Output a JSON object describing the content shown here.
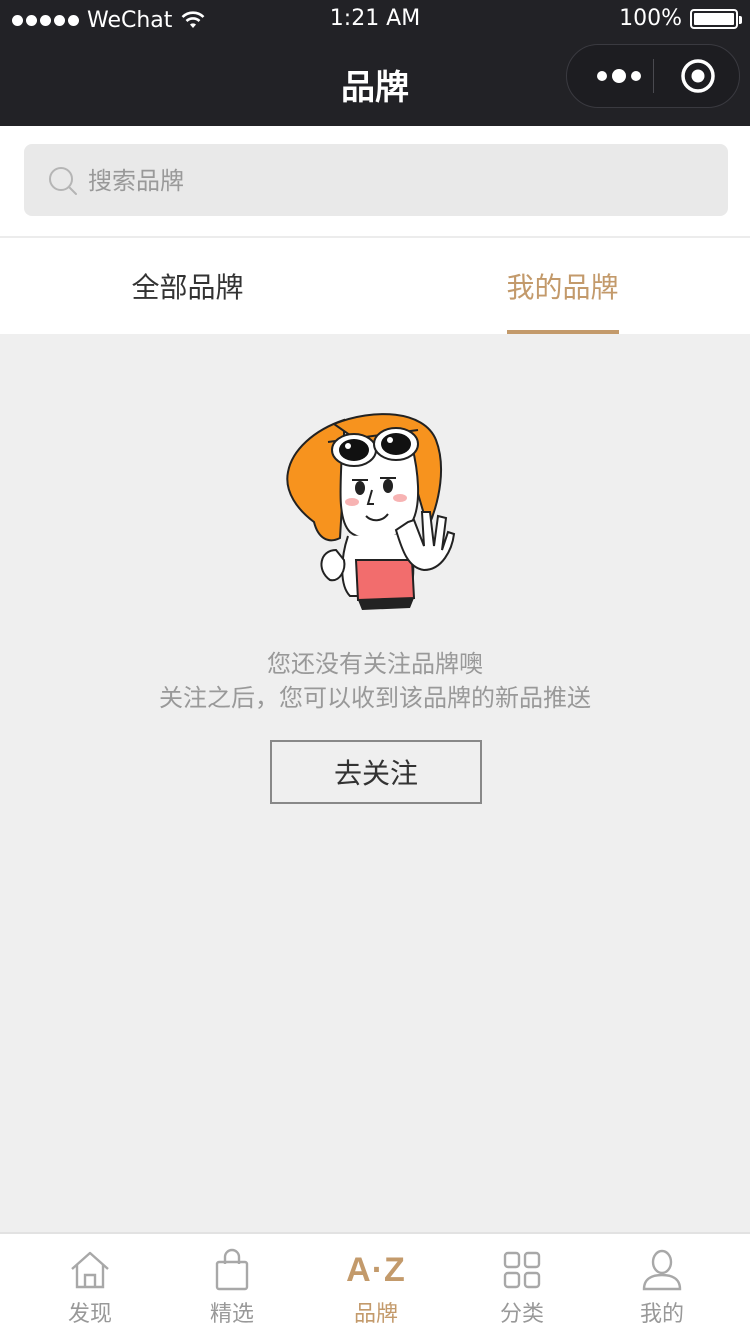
{
  "status_bar": {
    "carrier": "WeChat",
    "time": "1:21 AM",
    "battery": "100%"
  },
  "nav": {
    "title": "品牌"
  },
  "search": {
    "placeholder": "搜索品牌"
  },
  "tabs": [
    {
      "label": "全部品牌",
      "active": false
    },
    {
      "label": "我的品牌",
      "active": true
    }
  ],
  "empty_state": {
    "line1": "您还没有关注品牌噢",
    "line2": "关注之后，您可以收到该品牌的新品推送",
    "button": "去关注"
  },
  "tabbar": [
    {
      "label": "发现",
      "icon": "home-icon",
      "active": false
    },
    {
      "label": "精选",
      "icon": "shopping-bag-icon",
      "active": false
    },
    {
      "label": "品牌",
      "icon_text": "A·Z",
      "icon": "a-z-icon",
      "active": true
    },
    {
      "label": "分类",
      "icon": "grid-icon",
      "active": false
    },
    {
      "label": "我的",
      "icon": "user-icon",
      "active": false
    }
  ],
  "colors": {
    "accent": "#c39a6b",
    "nav_bg": "#222226",
    "page_bg": "#efefef"
  }
}
